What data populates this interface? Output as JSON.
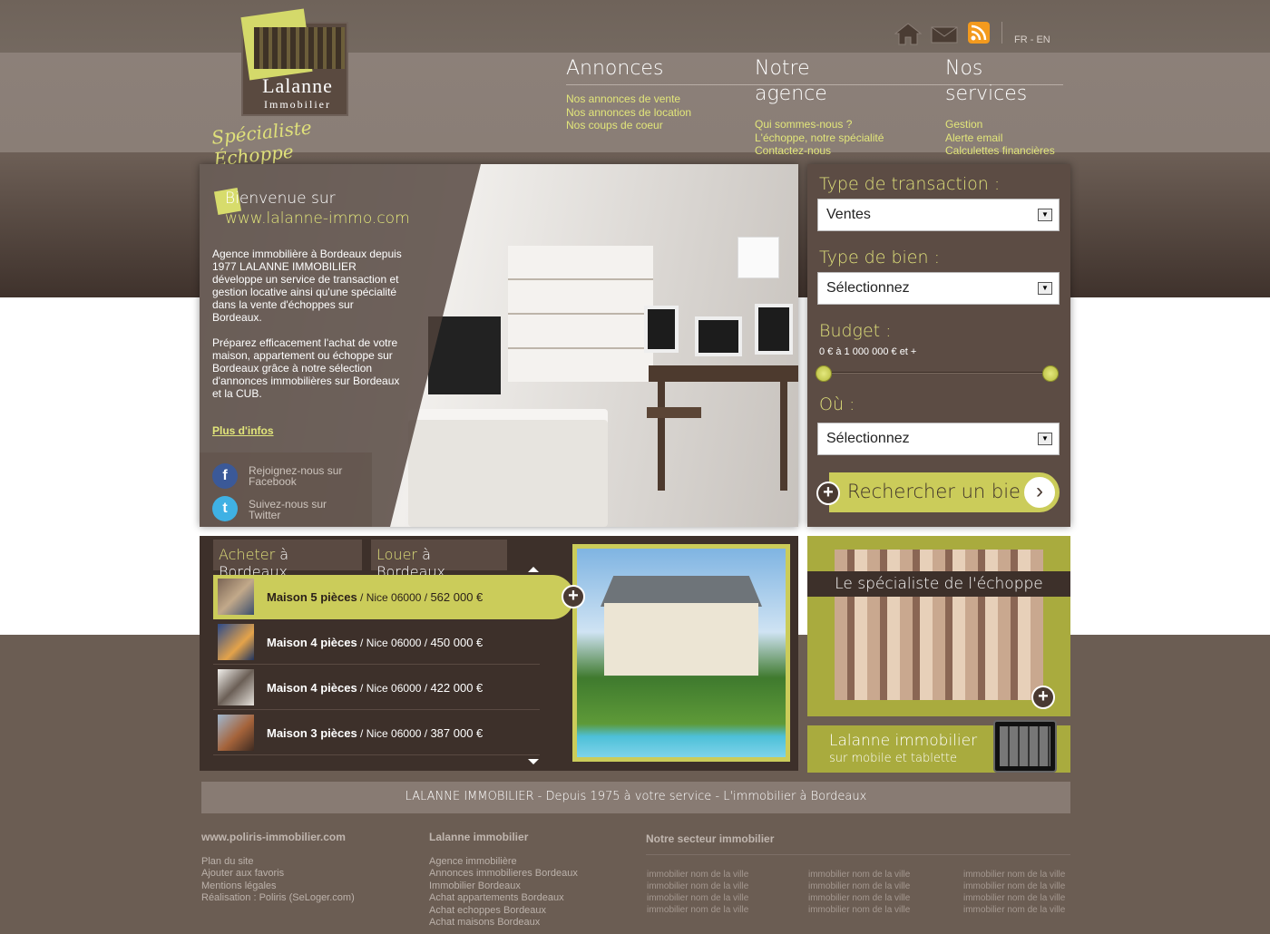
{
  "header": {
    "logo": {
      "name": "Lalanne",
      "sub": "Immobilier",
      "script": "Spécialiste Échoppe"
    },
    "icons": [
      "home-icon",
      "mail-icon",
      "rss-icon"
    ],
    "lang": "FR - EN"
  },
  "nav": [
    {
      "title": "Annonces",
      "links": [
        "Nos annonces de vente",
        "Nos annonces de location",
        "Nos coups de coeur"
      ]
    },
    {
      "title": "Notre agence",
      "links": [
        "Qui sommes-nous ?",
        "L'échoppe, notre spécialité",
        "Contactez-nous"
      ]
    },
    {
      "title": "Nos services",
      "links": [
        "Gestion",
        "Alerte email",
        "Calculettes financières"
      ]
    }
  ],
  "hero": {
    "welcome": "Bienvenue sur",
    "site": "www.lalanne-immo.com",
    "para1": "Agence immobilière à Bordeaux depuis 1977 LALANNE IMMOBILIER développe un service de transaction et gestion locative ainsi qu'une spécialité dans la vente d'échoppes sur Bordeaux.",
    "para2": "Préparez efficacement l'achat de votre maison, appartement ou échoppe sur Bordeaux grâce à notre sélection d'annonces immobilières sur Bordeaux et la CUB.",
    "more": "Plus d'infos",
    "facebook": [
      "Rejoignez-nous sur",
      "Facebook"
    ],
    "twitter": [
      "Suivez-nous sur",
      "Twitter"
    ]
  },
  "search": {
    "transaction_label": "Type de transaction :",
    "transaction_value": "Ventes",
    "bien_label": "Type de bien :",
    "bien_value": "Sélectionnez",
    "budget_label": "Budget :",
    "budget_value": "0 € à 1 000 000 € et +",
    "budget_min": 0,
    "budget_max": 1000000,
    "ou_label": "Où :",
    "ou_value": "Sélectionnez",
    "button": "Rechercher un bien"
  },
  "listings": {
    "tabs": [
      {
        "hl": "Acheter",
        "rest": " à Bordeaux"
      },
      {
        "hl": "Louer",
        "rest": " à Bordeaux"
      }
    ],
    "items": [
      {
        "title": "Maison 5 pièces",
        "loc": " / Nice 06000 / ",
        "price": "562 000 €"
      },
      {
        "title": "Maison 4 pièces",
        "loc": " / Nice 06000 / ",
        "price": "450 000 €"
      },
      {
        "title": "Maison 4 pièces",
        "loc": " / Nice 06000 / ",
        "price": "422 000 €"
      },
      {
        "title": "Maison 3 pièces",
        "loc": " / Nice 06000 / ",
        "price": "387 000 €"
      }
    ]
  },
  "promo": {
    "title": "Le spécialiste de l'échoppe"
  },
  "mobile": {
    "line1": "Lalanne immobilier",
    "line2": "sur mobile et tablette"
  },
  "footer": {
    "tagline": "LALANNE IMMOBILIER - Depuis 1975 à votre service - L'immobilier à Bordeaux",
    "col1": {
      "title": "www.poliris-immobilier.com",
      "links": [
        "Plan du site",
        "Ajouter aux favoris",
        "Mentions légales",
        "Réalisation : Poliris (SeLoger.com)"
      ]
    },
    "col2": {
      "title": "Lalanne immobilier",
      "links": [
        "Agence immobilière",
        "Annonces immobilieres Bordeaux",
        "Immobilier Bordeaux",
        "Achat appartements Bordeaux",
        "Achat echoppes Bordeaux",
        "Achat maisons Bordeaux"
      ]
    },
    "col3": {
      "title": "Notre secteur immobilier",
      "cell": "immobilier nom de la ville"
    }
  }
}
